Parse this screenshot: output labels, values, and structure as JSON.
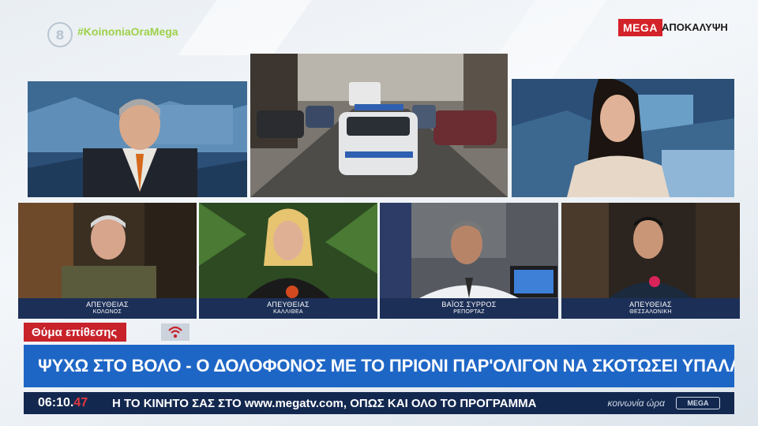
{
  "top_bar": {
    "channel_logo": "8",
    "hashtag": "#KoinoniaOraMega",
    "network_badge": "MEGA",
    "program_name": "ΑΠΟΚΑΛΥΨΗ"
  },
  "panels": [
    {
      "line1": "ΑΠΕΥΘΕΙΑΣ",
      "line2": "ΚΟΛΩΝΟΣ"
    },
    {
      "line1": "ΑΠΕΥΘΕΙΑΣ",
      "line2": "ΚΑΛΛΙΘΕΑ"
    },
    {
      "line1": "ΒΑΪΟΣ ΣΥΡΡΟΣ",
      "line2": "ΡΕΠΟΡΤΑΖ"
    },
    {
      "line1": "ΑΠΕΥΘΕΙΑΣ",
      "line2": "ΘΕΣΣΑΛΟΝΙΚΗ"
    }
  ],
  "lower_third": {
    "tag": "Θύμα επίθεσης",
    "headline": "ΨΥΧΩ ΣΤΟ ΒΟΛΟ - Ο ΔΟΛΟΦΟΝΟΣ ΜΕ ΤΟ ΠΡΙΟΝΙ ΠΑΡ'ΟΛΙΓΟΝ ΝΑ ΣΚΟΤΩΣΕΙ ΥΠΑΛΛΗΛΟ ΤΟΥ ΔΗΜΟΥ"
  },
  "ticker": {
    "time_main": "06:10.",
    "time_seconds": "47",
    "text": "Η ΤΟ ΚΙΝΗΤΟ ΣΑΣ ΣΤΟ www.megatv.com, ΟΠΩΣ ΚΑΙ ΟΛΟ ΤΟ ΠΡΟΓΡΑΜΜΑ",
    "show_name": "κοινωνία ώρα",
    "logo_text": "MEGA"
  },
  "colors": {
    "headline_blue": "#1e66c6",
    "tag_red": "#c8222a",
    "caption_navy": "#1c2f57",
    "ticker_navy": "#13284f",
    "hashtag_green": "#9ed14a"
  }
}
